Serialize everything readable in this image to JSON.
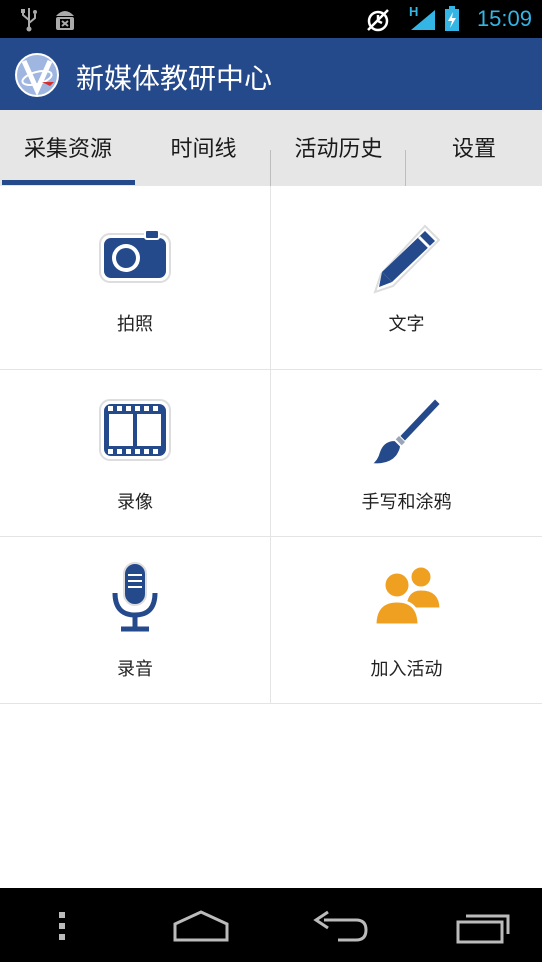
{
  "status_bar": {
    "time": "15:09",
    "icons": [
      "usb-icon",
      "android-debug-icon",
      "alarm-icon",
      "signal-icon",
      "battery-charging-icon"
    ],
    "network_label": "H"
  },
  "app_bar": {
    "title": "新媒体教研中心",
    "logo_icon": "app-logo-icon"
  },
  "tabs": [
    {
      "label": "采集资源",
      "active": true
    },
    {
      "label": "时间线",
      "active": false
    },
    {
      "label": "活动历史",
      "active": false
    },
    {
      "label": "设置",
      "active": false
    }
  ],
  "grid": [
    {
      "label": "拍照",
      "icon": "camera-icon"
    },
    {
      "label": "文字",
      "icon": "pencil-icon"
    },
    {
      "label": "录像",
      "icon": "film-icon"
    },
    {
      "label": "手写和涂鸦",
      "icon": "paintbrush-icon"
    },
    {
      "label": "录音",
      "icon": "microphone-icon"
    },
    {
      "label": "加入活动",
      "icon": "people-icon"
    }
  ],
  "colors": {
    "brand_blue": "#244a8c",
    "tab_background": "#e6e6e6",
    "status_accent": "#33b5e5",
    "people_orange": "#f0a020"
  },
  "nav_bar": {
    "icons": [
      "menu-icon",
      "home-icon",
      "back-icon",
      "recent-apps-icon"
    ]
  }
}
